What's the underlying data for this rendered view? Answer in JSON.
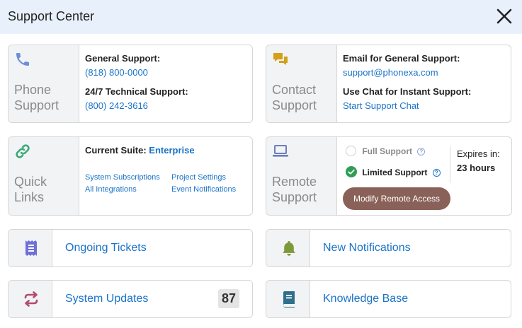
{
  "header": {
    "title": "Support Center"
  },
  "phone_support": {
    "label_line1": "Phone",
    "label_line2": "Support",
    "general_label": "General Support:",
    "general_number": "(818) 800-0000",
    "technical_label": "24/7 Technical Support:",
    "technical_number": "(800) 242-3616"
  },
  "contact_support": {
    "label_line1": "Contact",
    "label_line2": "Support",
    "email_label": "Email for General Support:",
    "email_address": "support@phonexa.com",
    "chat_label": "Use Chat for Instant Support:",
    "chat_link": "Start Support Chat"
  },
  "quick_links": {
    "label_line1": "Quick",
    "label_line2": "Links",
    "suite_label": "Current Suite:",
    "suite_value": "Enterprise",
    "links": [
      "System Subscriptions",
      "Project Settings",
      "All Integrations",
      "Event Notifications"
    ]
  },
  "remote_support": {
    "label_line1": "Remote",
    "label_line2": "Support",
    "full_support": "Full Support",
    "limited_support": "Limited Support",
    "expires_label": "Expires in:",
    "expires_value": "23 hours",
    "modify_button": "Modify Remote Access"
  },
  "tiles": {
    "ongoing_tickets": "Ongoing Tickets",
    "new_notifications": "New Notifications",
    "system_updates": "System Updates",
    "system_updates_count": "87",
    "knowledge_base": "Knowledge Base"
  },
  "colors": {
    "link": "#1a73c8",
    "header_bg": "#e8f1fb",
    "phone_icon": "#6b8fd9",
    "chat_icon": "#d4a017",
    "link_icon": "#3aaa78",
    "laptop_icon": "#6b7fb8",
    "ticket_icon": "#6f6fd8",
    "bell_icon": "#7d9a3a",
    "refresh_icon": "#b04d72",
    "book_icon": "#2f6f8c",
    "modify_button": "#8a6158",
    "check_green": "#2e9e55"
  },
  "icons": [
    "close-icon",
    "phone-icon",
    "chat-icon",
    "link-icon",
    "laptop-icon",
    "help-icon",
    "ticket-icon",
    "bell-icon",
    "refresh-icon",
    "book-icon"
  ]
}
